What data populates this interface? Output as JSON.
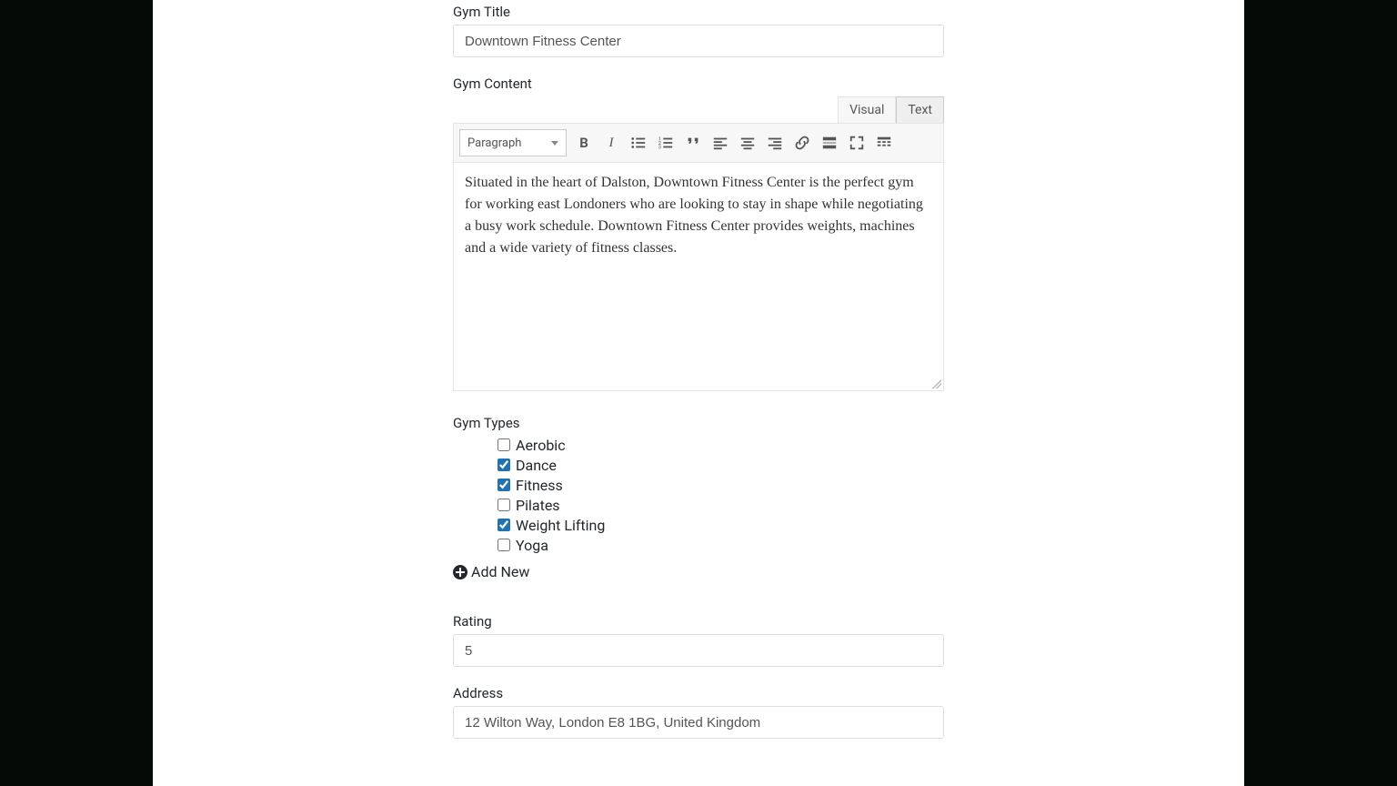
{
  "labels": {
    "gym_title": "Gym Title",
    "gym_content": "Gym Content",
    "gym_types": "Gym Types",
    "rating": "Rating",
    "address": "Address"
  },
  "gym_title_value": "Downtown Fitness Center",
  "editor": {
    "tab_visual": "Visual",
    "tab_text": "Text",
    "format_dd": "Paragraph",
    "content": "Situated in the heart of Dalston, Downtown Fitness Center is the perfect gym for working east Londoners who are looking to stay in shape while negotiating a busy work schedule. Downtown Fitness Center provides weights, machines and a wide variety of fitness classes."
  },
  "gym_types": [
    {
      "label": "Aerobic",
      "checked": false
    },
    {
      "label": "Dance",
      "checked": true
    },
    {
      "label": "Fitness",
      "checked": true
    },
    {
      "label": "Pilates",
      "checked": false
    },
    {
      "label": "Weight Lifting",
      "checked": true
    },
    {
      "label": "Yoga",
      "checked": false
    }
  ],
  "add_new_label": "Add New",
  "rating_value": "5",
  "address_value": "12 Wilton Way, London E8 1BG, United Kingdom"
}
